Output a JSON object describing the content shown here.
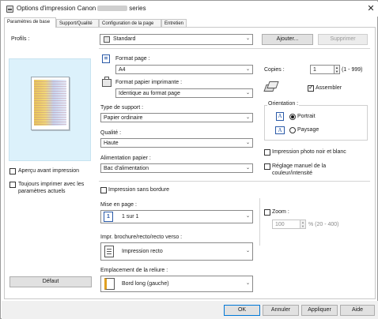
{
  "window": {
    "title_prefix": "Options d'impression Canon",
    "title_suffix": "series",
    "close": "✕"
  },
  "tabs": [
    "Paramètres de base",
    "Support/Qualité",
    "Configuration de la page",
    "Entretien"
  ],
  "profiles": {
    "label": "Profils :",
    "value": "Standard",
    "add_button": "Ajouter...",
    "delete_button": "Supprimer"
  },
  "left": {
    "preview_checkbox": "Aperçu avant impression",
    "always_print_line1": "Toujours imprimer avec les",
    "always_print_line2": "paramètres actuels",
    "default_button": "Défaut"
  },
  "page_size": {
    "label": "Format page :",
    "value": "A4"
  },
  "printer_paper_size": {
    "label": "Format papier imprimante :",
    "value": "Identique au format page"
  },
  "media_type": {
    "label": "Type de support :",
    "value": "Papier ordinaire"
  },
  "quality": {
    "label": "Qualité :",
    "value": "Haute"
  },
  "paper_source": {
    "label": "Alimentation papier :",
    "value": "Bac d'alimentation"
  },
  "copies": {
    "label": "Copies :",
    "value": "1",
    "range": "(1 - 999)",
    "collate_label": "Assembler",
    "collate_checked": true
  },
  "orientation": {
    "label": "Orientation :",
    "portrait": "Portrait",
    "landscape": "Paysage",
    "selected": "portrait"
  },
  "grayscale": {
    "label": "Impression photo noir et blanc",
    "checked": false
  },
  "manual_color": {
    "line1": "Réglage manuel de la",
    "line2": "couleur/intensité",
    "checked": false
  },
  "borderless": {
    "label": "Impression sans bordure",
    "checked": false
  },
  "layout": {
    "label": "Mise en page :",
    "value": "1 sur 1",
    "icon_text": "1"
  },
  "zoom": {
    "label": "Zoom :",
    "value": "100",
    "range": "% (20 - 400)",
    "checked": false
  },
  "duplex": {
    "label": "Impr. brochure/recto/recto verso :",
    "value": "Impression recto"
  },
  "binding": {
    "label": "Emplacement de la reliure :",
    "value": "Bord long (gauche)"
  },
  "footer": {
    "ok": "OK",
    "cancel": "Annuler",
    "apply": "Appliquer",
    "help": "Aide"
  },
  "colors": {
    "accent": "#0078d7",
    "preview_bg": "#dcf1fb"
  }
}
